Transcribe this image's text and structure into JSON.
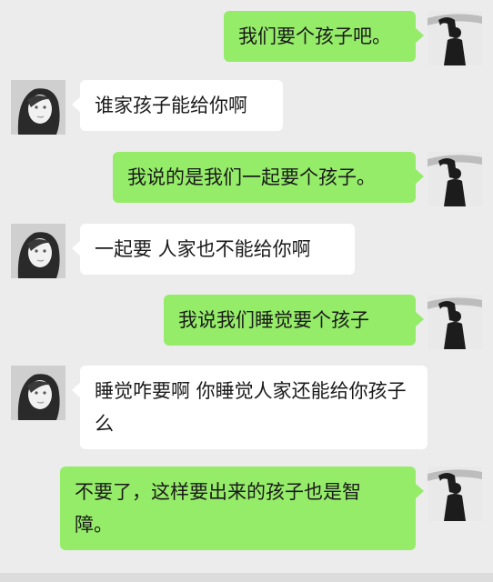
{
  "messages": [
    {
      "from": "me",
      "text": "我们要个孩子吧。"
    },
    {
      "from": "them",
      "text": "谁家孩子能给你啊"
    },
    {
      "from": "me",
      "text": "我说的是我们一起要个孩子。"
    },
    {
      "from": "them",
      "text": "一起要 人家也不能给你啊"
    },
    {
      "from": "me",
      "text": "我说我们睡觉要个孩子"
    },
    {
      "from": "them",
      "text": "睡觉咋要啊 你睡觉人家还能给你孩子么"
    },
    {
      "from": "me",
      "text": "不要了，这样要出来的孩子也是智障。"
    }
  ],
  "avatars": {
    "me": "silhouette-avatar-icon",
    "them": "girl-portrait-avatar-icon"
  },
  "colors": {
    "background": "#ececec",
    "my_bubble": "#95ec69",
    "their_bubble": "#ffffff"
  }
}
